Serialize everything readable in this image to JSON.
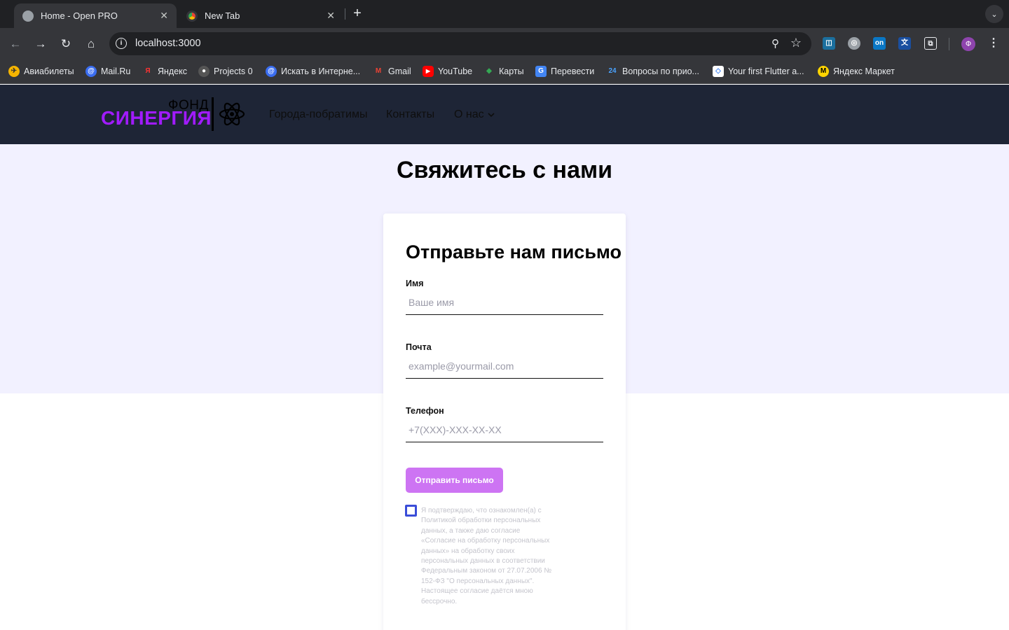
{
  "browser": {
    "tabs": [
      {
        "title": "Home - Open PRO",
        "active": true,
        "favicon": "globe-icon"
      },
      {
        "title": "New Tab",
        "active": false,
        "favicon": "chrome-icon"
      }
    ],
    "url": "localhost:3000",
    "profile_initial": "Ф",
    "bookmarks": [
      "Авиабилеты",
      "Mail.Ru",
      "Яндекс",
      "Projects 0",
      "Искать в Интерне...",
      "Gmail",
      "YouTube",
      "Карты",
      "Перевести",
      "Вопросы по прио...",
      "Your first Flutter a...",
      "Яндекс Маркет"
    ]
  },
  "header": {
    "logo_top": "ФОНД",
    "logo_main": "СИНЕРГИЯ",
    "nav": [
      "Города-побратимы",
      "Контакты",
      "О нас"
    ]
  },
  "page": {
    "title": "Свяжитесь с нами",
    "form": {
      "title": "Отправьте нам письмо",
      "fields": [
        {
          "label": "Имя",
          "placeholder": "Ваше имя",
          "value": ""
        },
        {
          "label": "Почта",
          "placeholder": "example@yourmail.com",
          "value": ""
        },
        {
          "label": "Телефон",
          "placeholder": "+7(XXX)-XXX-XX-XX",
          "value": ""
        }
      ],
      "submit_label": "Отправить письмо",
      "consent_checked": false,
      "consent_text": "Я подтверждаю, что ознакомлен(а) с Политикой обработки персональных данных, а также даю согласие «Согласие на обработку персональных данных» на обработку своих персональных данных в соответствии Федеральным законом от 27.07.2006 № 152-ФЗ \"О персональных данных\". Настоящее согласие даётся мною бессрочно."
    }
  },
  "colors": {
    "header_bg": "#1e2536",
    "hero_bg": "#f2f1ff",
    "brand_purple": "#a11bff",
    "button_bg": "#cd74f3",
    "checkbox_border": "#3a4dd8"
  }
}
